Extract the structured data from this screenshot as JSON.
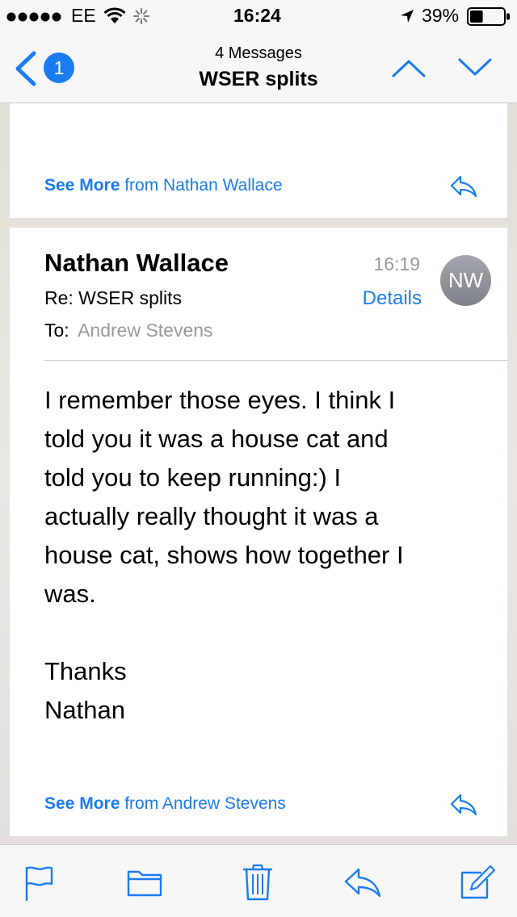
{
  "status_bar": {
    "carrier": "EE",
    "time": "16:24",
    "battery": "39%",
    "signal_dots": 5,
    "battery_level": 0.39
  },
  "nav": {
    "back_badge": "1",
    "messages_count": "4 Messages",
    "subject": "WSER splits"
  },
  "previous_card": {
    "see_more": "See More",
    "from_text": "from Nathan Wallace"
  },
  "message": {
    "sender": "Nathan Wallace",
    "time": "16:19",
    "subject": "Re: WSER splits",
    "details_label": "Details",
    "to_label": "To:",
    "to_name": "Andrew Stevens",
    "avatar_initials": "NW",
    "body_lines": [
      "I remember those eyes. I think I",
      "told you it was a house cat and",
      "told you to keep running:) I",
      "actually really thought it was a",
      "house cat, shows how together I",
      "was."
    ],
    "signoff_lines": [
      "Thanks",
      "Nathan"
    ],
    "see_more": "See More",
    "from_text": "from Andrew Stevens"
  },
  "toolbar": {
    "icons": [
      "flag-icon",
      "folder-icon",
      "trash-icon",
      "reply-icon",
      "compose-icon"
    ]
  },
  "colors": {
    "accent": "#1a7cf0",
    "avatar_bg": "#8e9198",
    "muted_text": "#999999"
  }
}
